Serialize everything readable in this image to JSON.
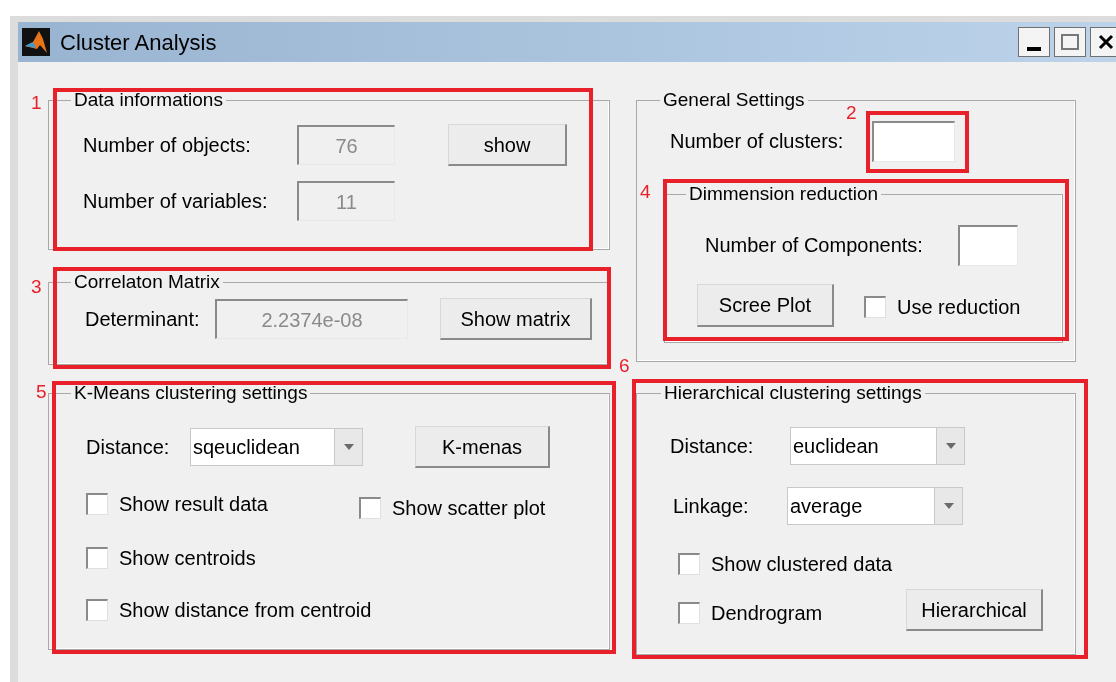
{
  "window": {
    "title": "Cluster Analysis"
  },
  "data_info": {
    "title": "Data informations",
    "objects_label": "Number of objects:",
    "objects": {
      "value": "76",
      "disabled": true
    },
    "variables_label": "Number of variables:",
    "variables": {
      "value": "11",
      "disabled": true
    },
    "button": "show"
  },
  "correlation": {
    "title": "Correlaton Matrix",
    "label": "Determinant:",
    "field": {
      "value": "2.2374e-08",
      "disabled": true
    },
    "button": "Show matrix"
  },
  "kmeans": {
    "title": "K-Means clustering settings",
    "distance_label": "Distance:",
    "distance": "sqeuclidean",
    "button": "K-menas",
    "checkboxes": [
      {
        "label": "Show result data",
        "checked": false
      },
      {
        "label": "Show scatter plot",
        "checked": false
      },
      {
        "label": "Show centroids",
        "checked": false
      },
      {
        "label": "Show distance from centroid",
        "checked": false
      }
    ]
  },
  "general": {
    "title": "General Settings",
    "clusters_label": "Number of clusters:",
    "clusters": {
      "disabled": false
    },
    "reduction": {
      "title": "Dimmension reduction",
      "components_label": "Number of Components:",
      "components": {
        "disabled": false
      },
      "button": "Scree Plot",
      "use_reduction": {
        "label": "Use reduction",
        "checked": false
      }
    }
  },
  "hierarchical": {
    "title": "Hierarchical clustering settings",
    "distance_label": "Distance:",
    "distance": "euclidean",
    "linkage_label": "Linkage:",
    "linkage": "average",
    "checkboxes": [
      {
        "label": "Show clustered data",
        "checked": false
      },
      {
        "label": "Dendrogram",
        "checked": false
      }
    ],
    "button": "Hierarchical"
  },
  "annotations": [
    {
      "label": "1"
    },
    {
      "label": "2"
    },
    {
      "label": "3"
    },
    {
      "label": "4"
    },
    {
      "label": "5"
    },
    {
      "label": "6"
    }
  ]
}
